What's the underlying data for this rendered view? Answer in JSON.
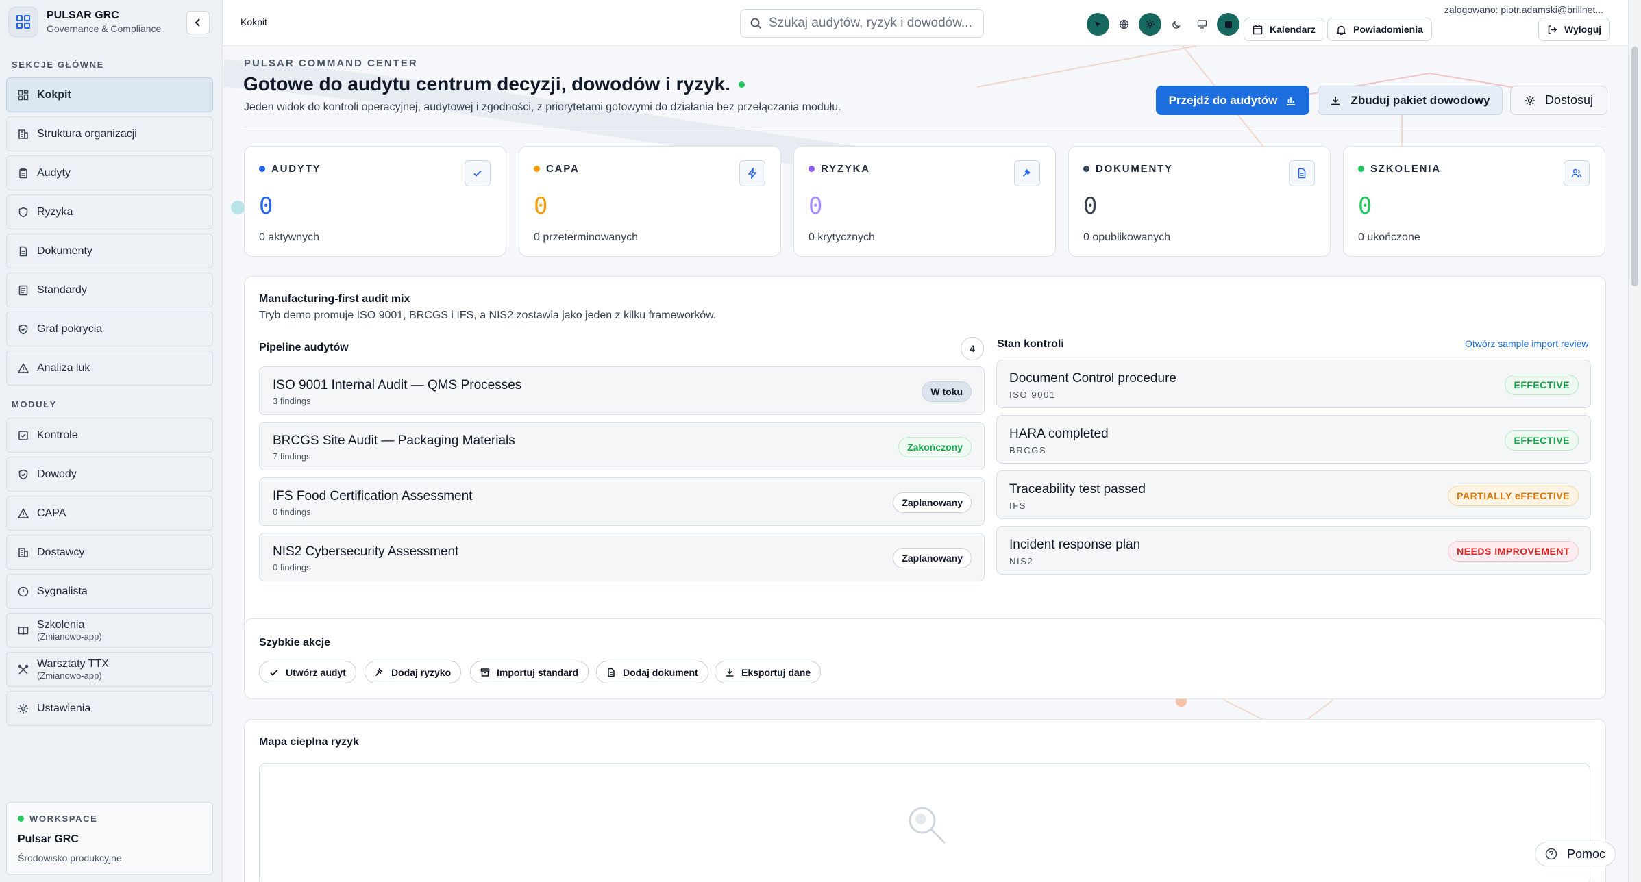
{
  "brand": {
    "name": "PULSAR GRC",
    "subtitle": "Governance & Compliance"
  },
  "sidebar": {
    "sections": {
      "main": "SEKCJE GŁÓWNE",
      "modules": "MODUŁY"
    },
    "main_items": [
      {
        "label": "Kokpit",
        "icon": "dashboard-icon",
        "active": true
      },
      {
        "label": "Struktura organizacji",
        "icon": "building-icon"
      },
      {
        "label": "Audyty",
        "icon": "clipboard-icon"
      },
      {
        "label": "Ryzyka",
        "icon": "shield-icon"
      },
      {
        "label": "Dokumenty",
        "icon": "document-icon"
      },
      {
        "label": "Standardy",
        "icon": "checklist-icon"
      },
      {
        "label": "Graf pokrycia",
        "icon": "shield-check-icon"
      },
      {
        "label": "Analiza luk",
        "icon": "warning-icon"
      }
    ],
    "module_items": [
      {
        "label": "Kontrole",
        "icon": "checkbox-icon"
      },
      {
        "label": "Dowody",
        "icon": "shield-check-icon"
      },
      {
        "label": "CAPA",
        "icon": "warning-icon"
      },
      {
        "label": "Dostawcy",
        "icon": "building-icon"
      },
      {
        "label": "Sygnalista",
        "icon": "alert-circle-icon"
      },
      {
        "label": "Szkolenia",
        "sub": "(Zmianowo-app)",
        "icon": "book-icon"
      },
      {
        "label": "Warsztaty TTX",
        "sub": "(Zmianowo-app)",
        "icon": "tools-icon"
      },
      {
        "label": "Ustawienia",
        "icon": "gear-icon"
      }
    ],
    "workspace": {
      "label": "WORKSPACE",
      "name": "Pulsar GRC",
      "env": "Środowisko produkcyjne"
    }
  },
  "topbar": {
    "breadcrumb": "Kokpit",
    "search_placeholder": "Szukaj audytów, ryzyk i dowodów...",
    "calendar": "Kalendarz",
    "notifications": "Powiadomienia",
    "logout": "Wyloguj",
    "user": "zalogowano: piotr.adamski@brillnet..."
  },
  "hero": {
    "eyebrow": "PULSAR COMMAND CENTER",
    "title": "Gotowe do audytu centrum decyzji, dowodów i ryzyk.",
    "description": "Jeden widok do kontroli operacyjnej, audytowej i zgodności, z priorytetami gotowymi do działania bez przełączania modułu.",
    "primary": "Przejdź do audytów",
    "secondary": "Zbuduj pakiet dowodowy",
    "customize": "Dostosuj"
  },
  "stats": [
    {
      "label": "AUDYTY",
      "value": "0",
      "sub": "0 aktywnych",
      "color": "#2563eb",
      "icon": "check-icon"
    },
    {
      "label": "CAPA",
      "value": "0",
      "sub": "0 przeterminowanych",
      "color": "#f59e0b",
      "icon": "bolt-icon"
    },
    {
      "label": "RYZYKA",
      "value": "0",
      "sub": "0 krytycznych",
      "color": "#8b5cf6",
      "icon": "gavel-icon"
    },
    {
      "label": "DOKUMENTY",
      "value": "0",
      "sub": "0 opublikowanych",
      "color": "#374151",
      "icon": "document-icon"
    },
    {
      "label": "SZKOLENIA",
      "value": "0",
      "sub": "0 ukończone",
      "color": "#22c55e",
      "icon": "users-icon"
    }
  ],
  "mix": {
    "title": "Manufacturing-first audit mix",
    "description": "Tryb demo promuje ISO 9001, BRCGS i IFS, a NIS2 zostawia jako jeden z kilku frameworków.",
    "pipeline_title": "Pipeline audytów",
    "pipeline_count": "4",
    "audits": [
      {
        "name": "ISO 9001 Internal Audit — QMS Processes",
        "findings": "3 findings",
        "status": "W toku",
        "kind": "progress"
      },
      {
        "name": "BRCGS Site Audit — Packaging Materials",
        "findings": "7 findings",
        "status": "Zakończony",
        "kind": "done"
      },
      {
        "name": "IFS Food Certification Assessment",
        "findings": "0 findings",
        "status": "Zaplanowany",
        "kind": "plan"
      },
      {
        "name": "NIS2 Cybersecurity Assessment",
        "findings": "0 findings",
        "status": "Zaplanowany",
        "kind": "plan"
      }
    ],
    "controls_title": "Stan kontroli",
    "controls_link": "Otwórz sample import review",
    "controls": [
      {
        "name": "Document Control procedure",
        "framework": "ISO 9001",
        "status": "EFFECTIVE",
        "kind": "ok"
      },
      {
        "name": "HARA completed",
        "framework": "BRCGS",
        "status": "EFFECTIVE",
        "kind": "ok"
      },
      {
        "name": "Traceability test passed",
        "framework": "IFS",
        "status": "PARTIALLY eFFECTIVE",
        "kind": "partial"
      },
      {
        "name": "Incident response plan",
        "framework": "NIS2",
        "status": "NEEDS IMPROVEMENT",
        "kind": "bad"
      }
    ]
  },
  "quick": {
    "title": "Szybkie akcje",
    "actions": [
      {
        "label": "Utwórz audyt",
        "icon": "check-icon"
      },
      {
        "label": "Dodaj ryzyko",
        "icon": "gavel-icon"
      },
      {
        "label": "Importuj standard",
        "icon": "archive-icon"
      },
      {
        "label": "Dodaj dokument",
        "icon": "document-icon"
      },
      {
        "label": "Eksportuj dane",
        "icon": "download-icon"
      }
    ]
  },
  "heatmap": {
    "title": "Mapa cieplna ryzyk"
  },
  "help": "Pomoc"
}
